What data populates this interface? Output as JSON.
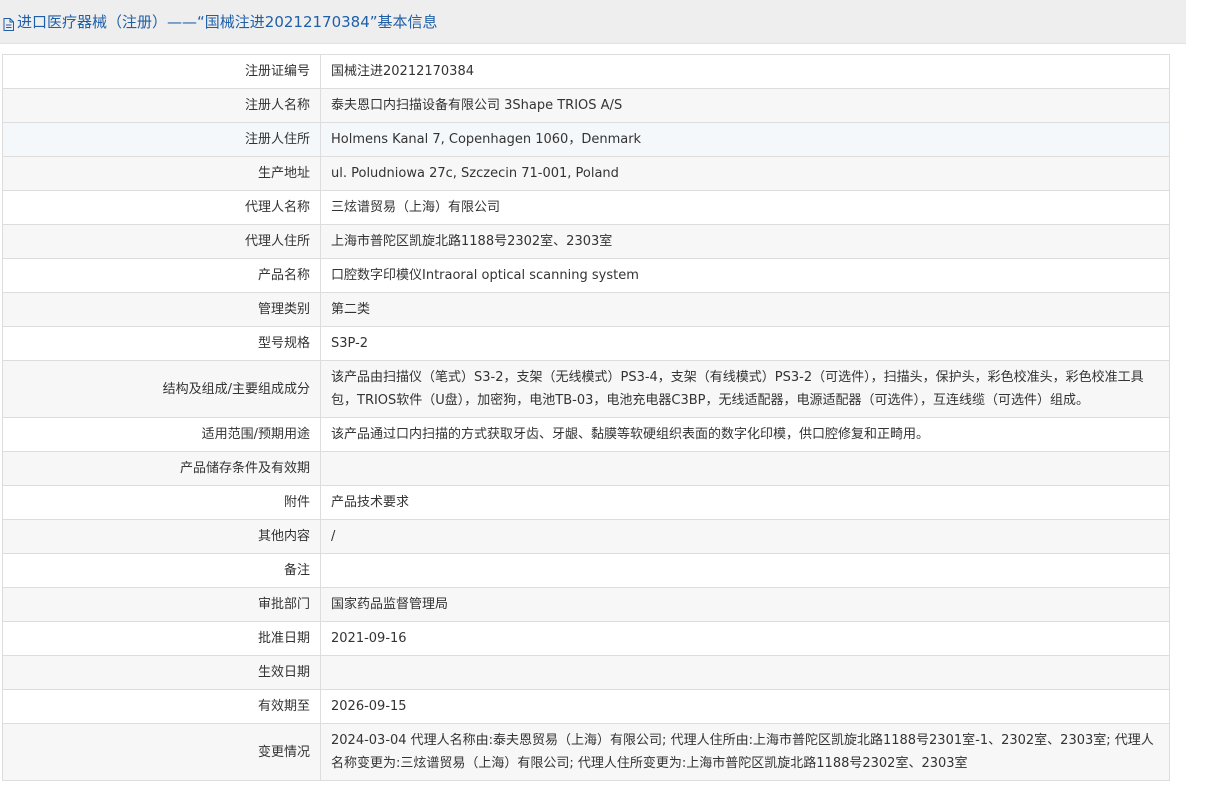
{
  "header": {
    "title": "进口医疗器械（注册）——“国械注进20212170384”基本信息"
  },
  "rows": [
    {
      "label": "注册证编号",
      "value": "国械注进20212170384"
    },
    {
      "label": "注册人名称",
      "value": "泰夫恩口内扫描设备有限公司 3Shape TRIOS A/S"
    },
    {
      "label": "注册人住所",
      "value": "Holmens Kanal 7, Copenhagen 1060，Denmark"
    },
    {
      "label": "生产地址",
      "value": "ul. Poludniowa 27c, Szczecin 71-001, Poland"
    },
    {
      "label": "代理人名称",
      "value": "三炫谱贸易（上海）有限公司"
    },
    {
      "label": "代理人住所",
      "value": "上海市普陀区凯旋北路1188号2302室、2303室"
    },
    {
      "label": "产品名称",
      "value": "口腔数字印模仪Intraoral optical scanning system"
    },
    {
      "label": "管理类别",
      "value": "第二类"
    },
    {
      "label": "型号规格",
      "value": "S3P-2"
    },
    {
      "label": "结构及组成/主要组成成分",
      "value": "该产品由扫描仪（笔式）S3-2，支架（无线模式）PS3-4，支架（有线模式）PS3-2（可选件），扫描头，保护头，彩色校准头，彩色校准工具包，TRIOS软件（U盘），加密狗，电池TB-03，电池充电器C3BP，无线适配器，电源适配器（可选件），互连线缆（可选件）组成。"
    },
    {
      "label": "适用范围/预期用途",
      "value": "该产品通过口内扫描的方式获取牙齿、牙龈、黏膜等软硬组织表面的数字化印模，供口腔修复和正畸用。"
    },
    {
      "label": "产品储存条件及有效期",
      "value": ""
    },
    {
      "label": "附件",
      "value": "产品技术要求"
    },
    {
      "label": "其他内容",
      "value": "/"
    },
    {
      "label": "备注",
      "value": ""
    },
    {
      "label": "审批部门",
      "value": "国家药品监督管理局"
    },
    {
      "label": "批准日期",
      "value": "2021-09-16"
    },
    {
      "label": "生效日期",
      "value": ""
    },
    {
      "label": "有效期至",
      "value": "2026-09-15"
    },
    {
      "label": "变更情况",
      "value": "2024-03-04 代理人名称由:泰夫恩贸易（上海）有限公司; 代理人住所由:上海市普陀区凯旋北路1188号2301室-1、2302室、2303室; 代理人名称变更为:三炫谱贸易（上海）有限公司; 代理人住所变更为:上海市普陀区凯旋北路1188号2302室、2303室"
    }
  ]
}
